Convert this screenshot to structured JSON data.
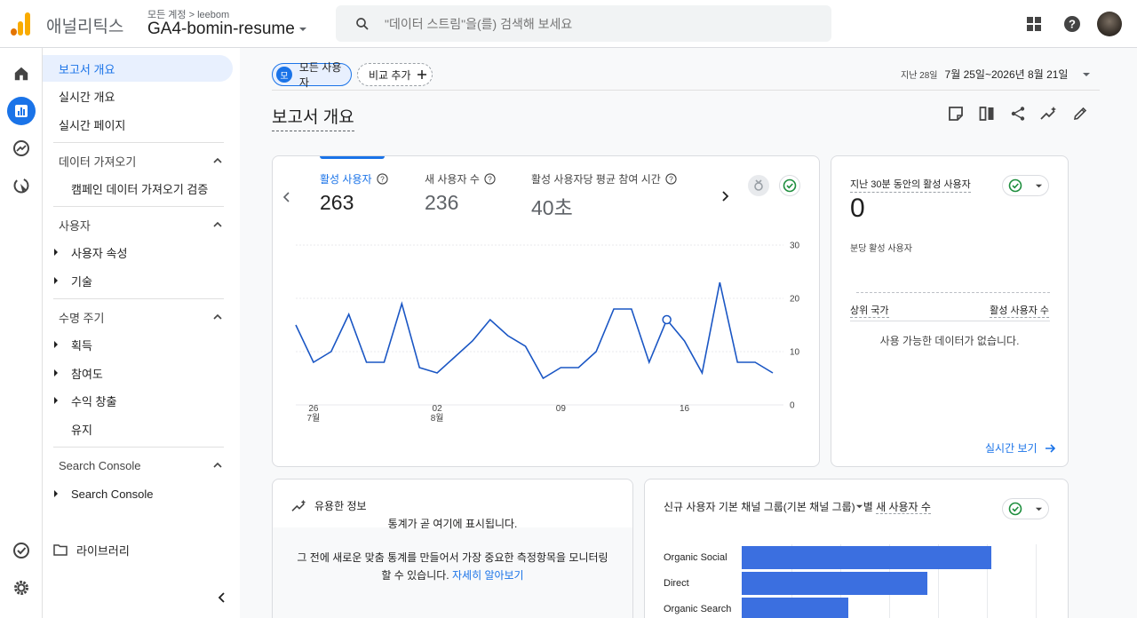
{
  "app": {
    "name": "애널리틱스",
    "account_crumb": "모든 계정 > leebom",
    "property": "GA4-bomin-resume"
  },
  "search": {
    "placeholder": "\"데이터 스트림\"을(를) 검색해 보세요"
  },
  "icons": {
    "apps": "apps-grid-icon",
    "help": "help-icon",
    "home": "home-icon",
    "reports": "reports-icon",
    "explore": "explore-icon",
    "advertising": "advertising-icon",
    "admin_check": "check-circle-icon",
    "settings": "gear-icon"
  },
  "colors": {
    "accent": "#1a73e8",
    "logo_orange": "#f9ab00",
    "logo_dark": "#e37400",
    "bar": "#3b6fe0"
  },
  "nav": {
    "report_overview": "보고서 개요",
    "realtime_overview": "실시간 개요",
    "realtime_pages": "실시간 페이지",
    "data_import": "데이터 가져오기",
    "campaign_import": "캠페인 데이터 가져오기 검증",
    "users": "사용자",
    "user_attributes": "사용자 속성",
    "tech": "기술",
    "lifecycle": "수명 주기",
    "acquisition": "획득",
    "engagement": "참여도",
    "monetization": "수익 창출",
    "retention": "유지",
    "search_console_section": "Search Console",
    "search_console_item": "Search Console",
    "library": "라이브러리"
  },
  "filters": {
    "segment_avatar": "모",
    "segment": "모든 사용자",
    "compare": "비교 추가",
    "date_prefix": "지난 28일",
    "date_range": "7월 25일~2026년 8월 21일"
  },
  "page_title": "보고서 개요",
  "metrics": [
    {
      "label": "활성 사용자",
      "value": "263"
    },
    {
      "label": "새 사용자 수",
      "value": "236"
    },
    {
      "label": "활성 사용자당 평균 참여 시간",
      "value": "40초"
    }
  ],
  "chart_data": {
    "type": "line",
    "series": [
      {
        "values": [
          15,
          8,
          10,
          17,
          8,
          8,
          19,
          7,
          6,
          9,
          12,
          16,
          13,
          11,
          5,
          7,
          7,
          10,
          18,
          18,
          8,
          16,
          12,
          6,
          23,
          8,
          8,
          6
        ]
      }
    ],
    "x_ticks": [
      {
        "index": 1,
        "day": "26",
        "month": "7월"
      },
      {
        "index": 8,
        "day": "02",
        "month": "8월"
      },
      {
        "index": 15,
        "day": "09",
        "month": ""
      },
      {
        "index": 22,
        "day": "16",
        "month": ""
      }
    ],
    "y_ticks": [
      "30",
      "20",
      "10",
      "0"
    ],
    "ylim": [
      0,
      30
    ],
    "highlight_index": 21
  },
  "realtime": {
    "title": "지난 30분 동안의 활성 사용자",
    "value": "0",
    "per_minute": "분당 활성 사용자",
    "col_country": "상위 국가",
    "col_users": "활성 사용자 수",
    "empty": "사용 가능한 데이터가 없습니다.",
    "link": "실시간 보기"
  },
  "insights": {
    "title": "유용한 정보",
    "empty_title": "통계가 곧 여기에 표시됩니다.",
    "desc": "그 전에 새로운 맞춤 통계를 만들어서 가장 중요한 측정항목을 모니터링할 수",
    "desc_tail_prefix": "있습니다.",
    "desc_link": "자세히 알아보기"
  },
  "channel": {
    "title_prefix": "신규 사용자 기본 채널 그룹(기본 채널 그룹)",
    "title_mid": "별",
    "title_metric": "새 사용자 수",
    "rows": [
      {
        "label": "Organic Social",
        "value": 0.94
      },
      {
        "label": "Direct",
        "value": 0.7
      },
      {
        "label": "Organic Search",
        "value": 0.4
      }
    ]
  }
}
